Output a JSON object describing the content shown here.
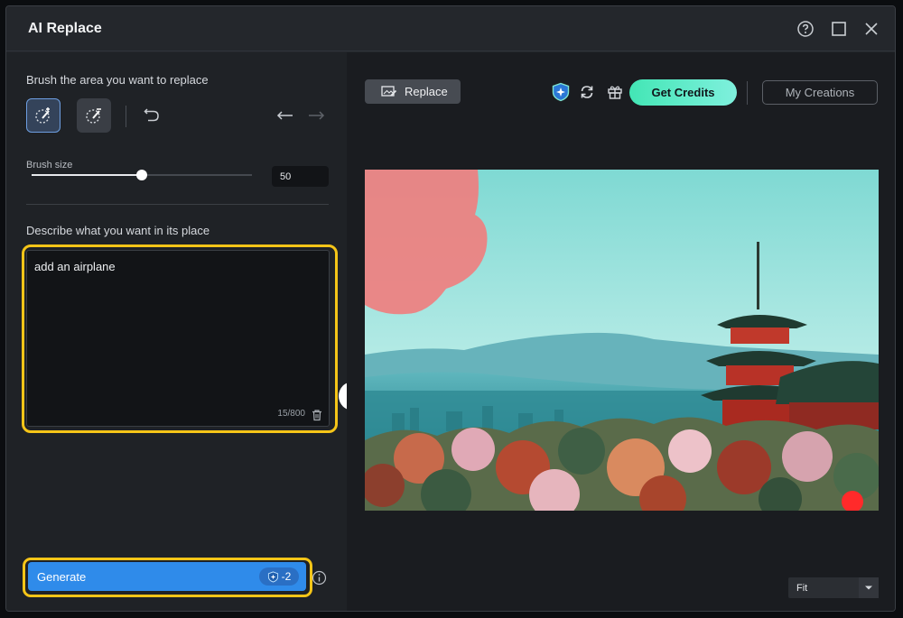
{
  "window": {
    "title": "AI Replace"
  },
  "left_panel": {
    "brush_heading": "Brush the area you want to replace",
    "brush_size_label": "Brush size",
    "brush_size_value": "50",
    "brush_size_fraction": 0.5,
    "describe_heading": "Describe what you want in its place",
    "prompt_text": "add an airplane",
    "char_count": "15/800",
    "generate_label": "Generate",
    "generate_cost": "-2"
  },
  "right_panel": {
    "replace_label": "Replace",
    "get_credits_label": "Get Credits",
    "my_creations_label": "My Creations",
    "zoom_value": "Fit"
  },
  "icons": {
    "help": "help-circle-icon",
    "maximize": "maximize-icon",
    "close": "close-icon",
    "brush_add": "brush-add-icon",
    "brush_erase": "brush-erase-icon",
    "reset": "reset-icon",
    "undo": "undo-icon",
    "redo": "redo-icon",
    "delete": "trash-icon",
    "info": "info-icon",
    "credit": "credit-icon",
    "refresh": "refresh-icon",
    "gift": "gift-icon",
    "grammarly": "grammarly-icon",
    "bulb": "lightbulb-icon",
    "chevron": "chevron-down-icon"
  },
  "colors": {
    "accent": "#2f8bea",
    "highlight": "#f5c518",
    "credits_gradient_start": "#43e6b5",
    "mask": "#ef7f7f"
  }
}
